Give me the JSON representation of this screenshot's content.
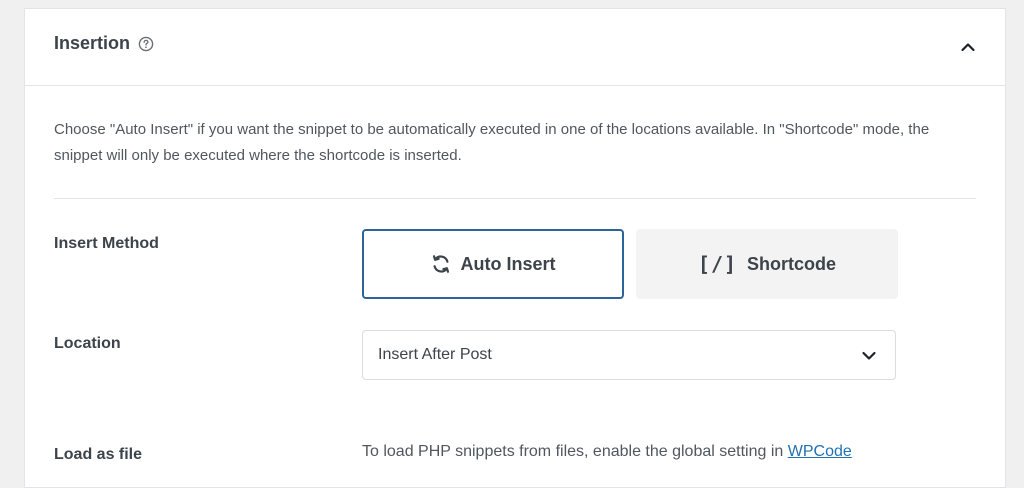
{
  "panel": {
    "title": "Insertion",
    "description": "Choose \"Auto Insert\" if you want the snippet to be automatically executed in one of the locations available. In \"Shortcode\" mode, the snippet will only be executed where the shortcode is inserted."
  },
  "icons": {
    "help": "question-circle-icon",
    "collapse": "chevron-up-icon",
    "auto_insert": "refresh-arrows-icon",
    "select": "chevron-down-icon"
  },
  "insert_method": {
    "label": "Insert Method",
    "options": [
      {
        "label": "Auto Insert",
        "selected": true
      },
      {
        "label": "Shortcode",
        "glyph": "[/]",
        "selected": false
      }
    ]
  },
  "location": {
    "label": "Location",
    "selected": "Insert After Post"
  },
  "load_as_file": {
    "label": "Load as file",
    "note": "To load PHP snippets from files, enable the global setting in",
    "link": "WPCode"
  },
  "colors": {
    "accent": "#2c6496",
    "link": "#2271b1",
    "text": "#3c434a",
    "muted": "#50575e",
    "border": "#e2e4e7",
    "button_bg": "#f3f3f3"
  }
}
